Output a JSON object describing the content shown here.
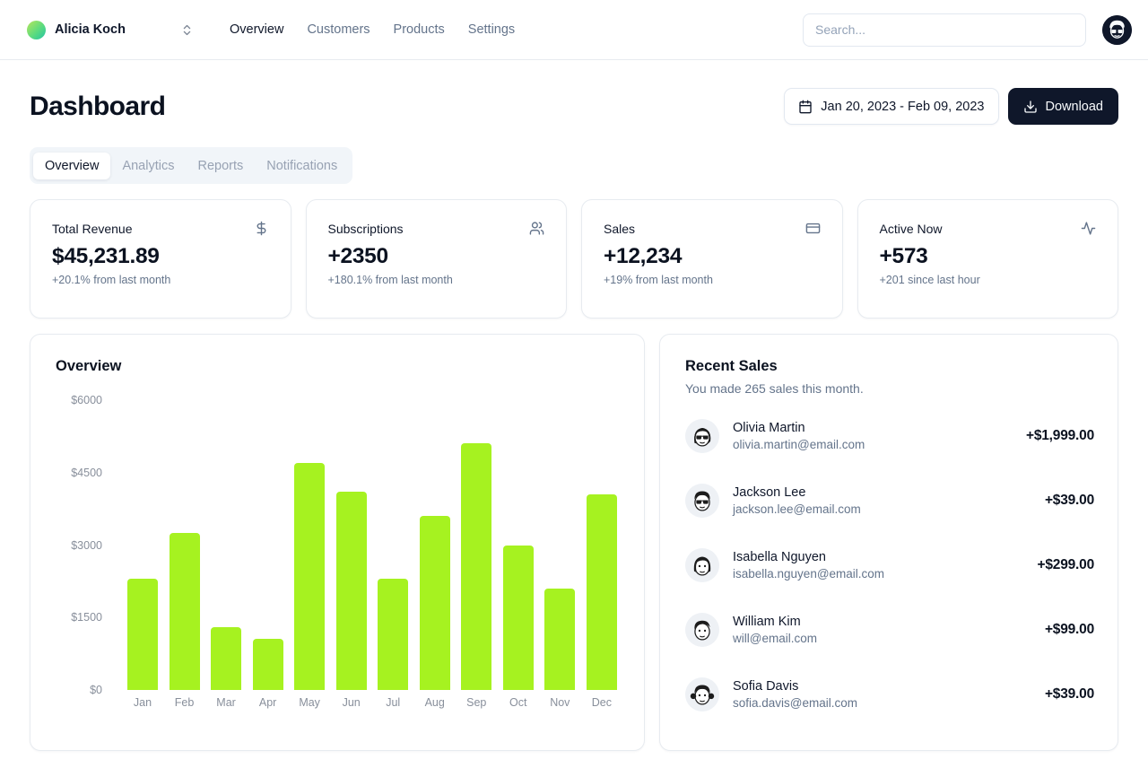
{
  "nav": {
    "team": {
      "name": "Alicia Koch"
    },
    "links": [
      {
        "label": "Overview",
        "active": true
      },
      {
        "label": "Customers",
        "active": false
      },
      {
        "label": "Products",
        "active": false
      },
      {
        "label": "Settings",
        "active": false
      }
    ],
    "search": {
      "placeholder": "Search..."
    }
  },
  "header": {
    "title": "Dashboard",
    "date_range": "Jan 20, 2023 - Feb 09, 2023",
    "download_label": "Download"
  },
  "tabs": [
    {
      "label": "Overview",
      "active": true
    },
    {
      "label": "Analytics",
      "active": false
    },
    {
      "label": "Reports",
      "active": false
    },
    {
      "label": "Notifications",
      "active": false
    }
  ],
  "stats": [
    {
      "label": "Total Revenue",
      "icon": "dollar-icon",
      "value": "$45,231.89",
      "change": "+20.1% from last month"
    },
    {
      "label": "Subscriptions",
      "icon": "users-icon",
      "value": "+2350",
      "change": "+180.1% from last month"
    },
    {
      "label": "Sales",
      "icon": "credit-card-icon",
      "value": "+12,234",
      "change": "+19% from last month"
    },
    {
      "label": "Active Now",
      "icon": "activity-icon",
      "value": "+573",
      "change": "+201 since last hour"
    }
  ],
  "chart_data": {
    "type": "bar",
    "title": "Overview",
    "categories": [
      "Jan",
      "Feb",
      "Mar",
      "Apr",
      "May",
      "Jun",
      "Jul",
      "Aug",
      "Sep",
      "Oct",
      "Nov",
      "Dec"
    ],
    "values": [
      2300,
      3250,
      1300,
      1050,
      4700,
      4100,
      2300,
      3600,
      5100,
      3000,
      2100,
      4050
    ],
    "xlabel": "",
    "ylabel": "",
    "ylim": [
      0,
      6000
    ],
    "yticks": [
      6000,
      4500,
      3000,
      1500,
      0
    ],
    "y_tick_labels": [
      "$6000",
      "$4500",
      "$3000",
      "$1500",
      "$0"
    ],
    "grid": false,
    "legend": false,
    "bar_color": "#a6f220"
  },
  "recent_sales": {
    "title": "Recent Sales",
    "subtitle": "You made 265 sales this month.",
    "items": [
      {
        "name": "Olivia Martin",
        "email": "olivia.martin@email.com",
        "amount": "+$1,999.00",
        "avatar": "woman-sunglasses"
      },
      {
        "name": "Jackson Lee",
        "email": "jackson.lee@email.com",
        "amount": "+$39.00",
        "avatar": "man-sunglasses"
      },
      {
        "name": "Isabella Nguyen",
        "email": "isabella.nguyen@email.com",
        "amount": "+$299.00",
        "avatar": "woman-bob"
      },
      {
        "name": "William Kim",
        "email": "will@email.com",
        "amount": "+$99.00",
        "avatar": "man-hair"
      },
      {
        "name": "Sofia Davis",
        "email": "sofia.davis@email.com",
        "amount": "+$39.00",
        "avatar": "woman-pigtails"
      }
    ]
  },
  "colors": {
    "accent_bar": "#a6f220",
    "primary_dark": "#0f172a",
    "muted_text": "#64748b",
    "border": "#e7ebf0",
    "tab_bg": "#f1f5f9",
    "logo_gradient_start": "#b7e65c",
    "logo_gradient_end": "#23c3a4"
  }
}
